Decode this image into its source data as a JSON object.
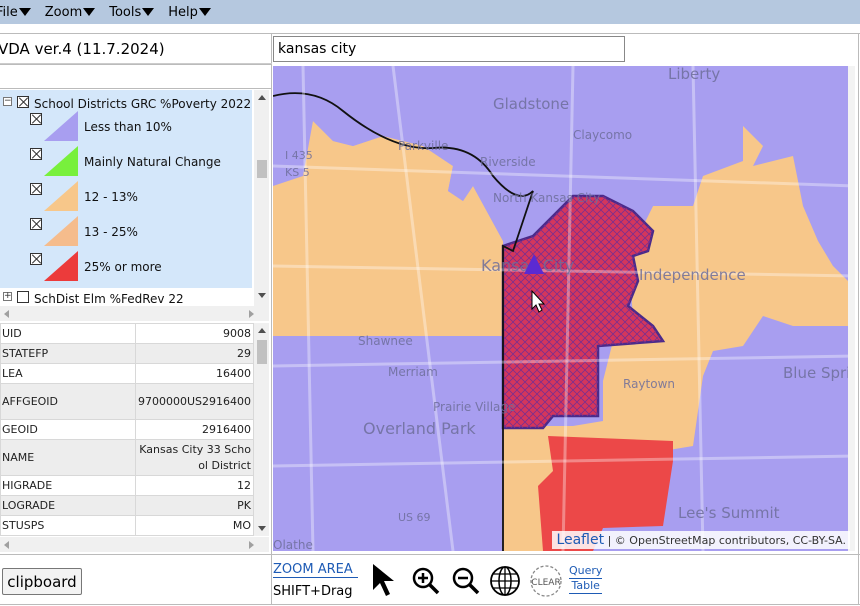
{
  "menu": [
    {
      "label": "File"
    },
    {
      "label": "Zoom"
    },
    {
      "label": "Tools"
    },
    {
      "label": "Help"
    }
  ],
  "app_title": "VDA ver.4 (11.7.2024)",
  "search": {
    "value": "kansas city"
  },
  "legend": {
    "layer1": {
      "title": "School Districts GRC %Poverty 2022",
      "items": [
        {
          "label": "Less than 10%",
          "color": "#a89ef0"
        },
        {
          "label": "Mainly Natural Change",
          "color": "#78f03c"
        },
        {
          "label": "12 - 13%",
          "color": "#f7c78a"
        },
        {
          "label": "13 - 25%",
          "color": "#f5bc8c"
        },
        {
          "label": "25% or more",
          "color": "#ec3b3b"
        }
      ]
    },
    "layer2": {
      "title": "SchDist Elm %FedRev 22"
    }
  },
  "attributes": [
    {
      "key": "UID",
      "value": "9008"
    },
    {
      "key": "STATEFP",
      "value": "29"
    },
    {
      "key": "LEA",
      "value": "16400"
    },
    {
      "key": "AFFGEOID",
      "value": "9700000US2916400"
    },
    {
      "key": "GEOID",
      "value": "2916400"
    },
    {
      "key": "NAME",
      "value": "Kansas City 33 School District"
    },
    {
      "key": "HIGRADE",
      "value": "12"
    },
    {
      "key": "LOGRADE",
      "value": "PK"
    },
    {
      "key": "STUSPS",
      "value": "MO"
    }
  ],
  "clipboard_label": "clipboard",
  "toolbar": {
    "zoom_area": "ZOOM AREA",
    "shift_drag": "SHIFT+Drag",
    "clear": "CLEAR",
    "query": "Query",
    "table": "Table"
  },
  "map": {
    "places": [
      "Liberty",
      "Gladstone",
      "Claycomo",
      "Parkville",
      "Riverside",
      "North Kansas City",
      "Kansas City",
      "Independence",
      "Shawnee",
      "Merriam",
      "Raytown",
      "Blue Springs",
      "Prairie Village",
      "Overland Park",
      "Lee's Summit",
      "Olathe",
      "I 435",
      "KS 5",
      "US 69"
    ],
    "attribution_link": "Leaflet",
    "attribution_text": " | © OpenStreetMap contributors, CC-BY-SA."
  },
  "colors": {
    "menubar": "#b5c8df",
    "legend_bg": "#d4e7fa",
    "link": "#1e5bb5",
    "lt10": "#a89ef0",
    "mid": "#f7c78a",
    "high": "#ec3b3b",
    "selected": "#d4365c"
  }
}
